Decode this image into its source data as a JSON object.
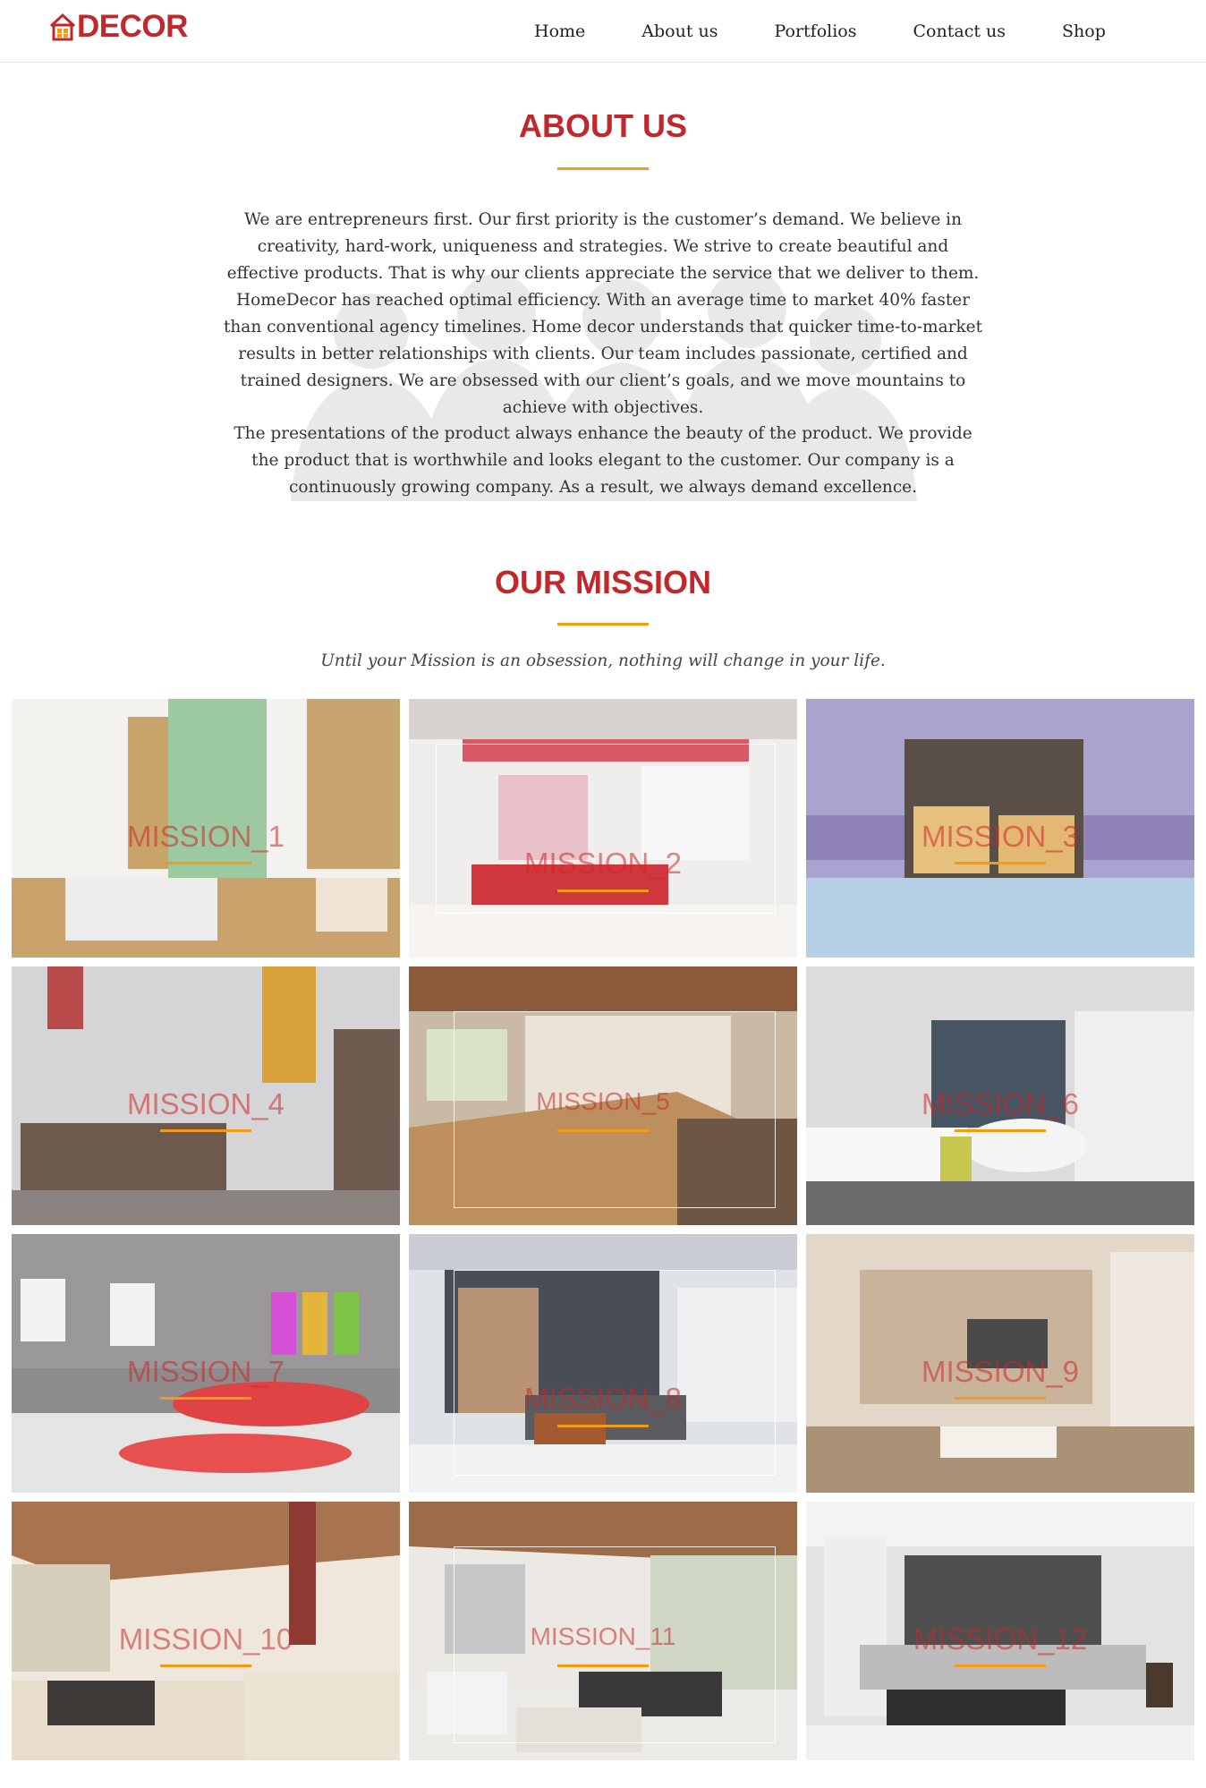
{
  "header": {
    "logo_text": "DECOR",
    "nav": [
      "Home",
      "About us",
      "Portfolios",
      "Contact us",
      "Shop"
    ]
  },
  "about": {
    "title": "ABOUT US",
    "paragraphs": [
      "We are entrepreneurs first. Our first priority is the customer’s demand. We believe in creativity, hard-work, uniqueness and strategies. We strive to create beautiful and effective products. That is why our clients appreciate the service that we deliver to them. HomeDecor has reached optimal efficiency. With an average time to market 40% faster than conventional agency timelines. Home decor understands that quicker time-to-market results in better relationships with clients. Our team includes passionate, certified and trained designers. We are obsessed with our client’s goals, and we move mountains to achieve with objectives.",
      "The presentations of the product always enhance the beauty of the product. We provide the product that is worthwhile and looks elegant to the customer. Our company is a continuously growing company. As a result, we always demand excellence."
    ]
  },
  "mission": {
    "title": "OUR MISSION",
    "subtitle": "Until your Mission is an obsession, nothing will change in your life.",
    "tiles": [
      {
        "label": "MISSION_1"
      },
      {
        "label": "MISSION_2"
      },
      {
        "label": "MISSION_3"
      },
      {
        "label": "MISSION_4"
      },
      {
        "label": "MISSION_5"
      },
      {
        "label": "MISSION_6"
      },
      {
        "label": "MISSION_7"
      },
      {
        "label": "MISSION_8"
      },
      {
        "label": "MISSION_9"
      },
      {
        "label": "MISSION_10"
      },
      {
        "label": "MISSION_11"
      },
      {
        "label": "MISSION_12"
      }
    ]
  },
  "colors": {
    "brand_red": "#c0282b",
    "accent_orange": "#f39c12"
  }
}
